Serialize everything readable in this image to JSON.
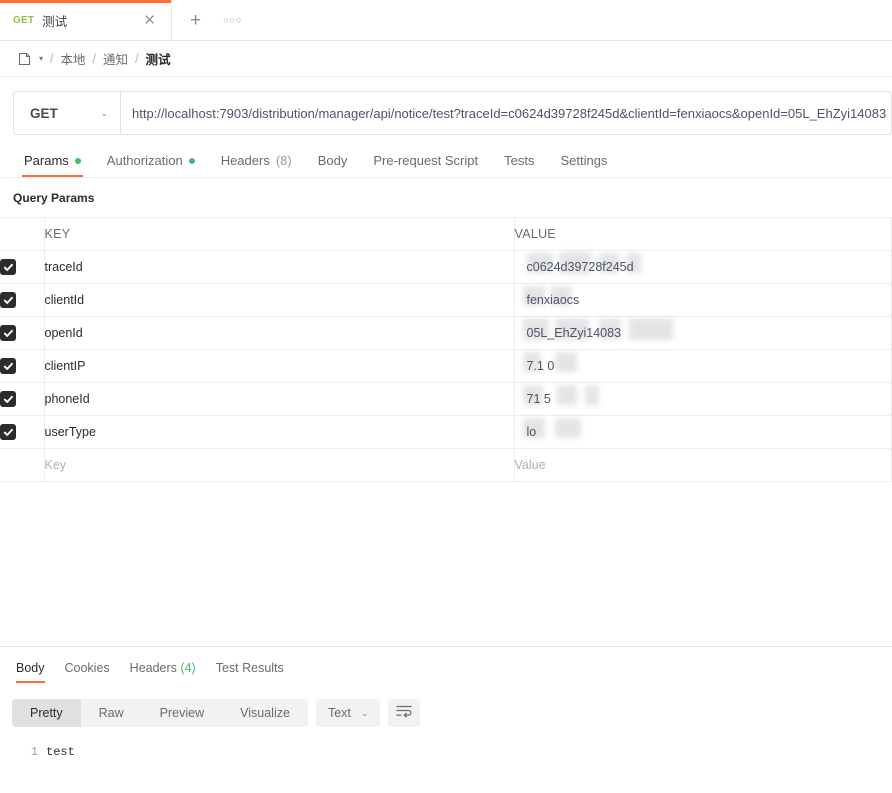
{
  "theme": {
    "accent": "#ff6c37",
    "green_dot": "#45bb68",
    "method_green": "#8bc34a",
    "checkbox_dark": "#2c2c2c"
  },
  "tabbar": {
    "tab": {
      "method": "GET",
      "title": "测试",
      "close_label": "✕"
    },
    "new_tab_label": "+",
    "more_label": "○○○"
  },
  "breadcrumb": {
    "folder_icon": "folder-icon",
    "caret": "▾",
    "separator": "/",
    "items": [
      {
        "label": "本地",
        "current": false
      },
      {
        "label": "通知",
        "current": false
      },
      {
        "label": "测试",
        "current": true
      }
    ]
  },
  "request": {
    "method": "GET",
    "method_caret": "⌄",
    "url": "http://localhost:7903/distribution/manager/api/notice/test?traceId=c0624d39728f245d&clientId=fenxiaocs&openId=05L_EhZyi14083",
    "tabs": [
      {
        "label": "Params",
        "dot": true,
        "count": "",
        "active": true
      },
      {
        "label": "Authorization",
        "dot": true,
        "count": "",
        "active": false
      },
      {
        "label": "Headers",
        "dot": false,
        "count": "(8)",
        "active": false
      },
      {
        "label": "Body",
        "dot": false,
        "count": "",
        "active": false
      },
      {
        "label": "Pre-request Script",
        "dot": false,
        "count": "",
        "active": false
      },
      {
        "label": "Tests",
        "dot": false,
        "count": "",
        "active": false
      },
      {
        "label": "Settings",
        "dot": false,
        "count": "",
        "active": false
      }
    ]
  },
  "params": {
    "section_title": "Query Params",
    "headers": {
      "key": "KEY",
      "value": "VALUE"
    },
    "rows": [
      {
        "checked": true,
        "key": "traceId",
        "value": "c0624d39728f245d",
        "redacted": true
      },
      {
        "checked": true,
        "key": "clientId",
        "value": "fenxiaocs",
        "redacted": true
      },
      {
        "checked": true,
        "key": "openId",
        "value": "05L_EhZyi14083",
        "redacted": true
      },
      {
        "checked": true,
        "key": "clientIP",
        "value": "7.1 0",
        "redacted": true
      },
      {
        "checked": true,
        "key": "phoneId",
        "value": "71 5",
        "redacted": true
      },
      {
        "checked": true,
        "key": "userType",
        "value": "lo",
        "redacted": true
      }
    ],
    "empty_row": {
      "key_placeholder": "Key",
      "value_placeholder": "Value"
    }
  },
  "response": {
    "tabs": [
      {
        "label": "Body",
        "count": "",
        "active": true
      },
      {
        "label": "Cookies",
        "count": "",
        "active": false
      },
      {
        "label": "Headers",
        "count": "(4)",
        "active": false
      },
      {
        "label": "Test Results",
        "count": "",
        "active": false
      }
    ],
    "formats": [
      {
        "label": "Pretty",
        "active": true
      },
      {
        "label": "Raw",
        "active": false
      },
      {
        "label": "Preview",
        "active": false
      },
      {
        "label": "Visualize",
        "active": false
      }
    ],
    "type_select": {
      "label": "Text",
      "caret": "⌄"
    },
    "wrap_icon": "word-wrap-icon",
    "body_lines": [
      {
        "num": "1",
        "text": "test"
      }
    ]
  }
}
